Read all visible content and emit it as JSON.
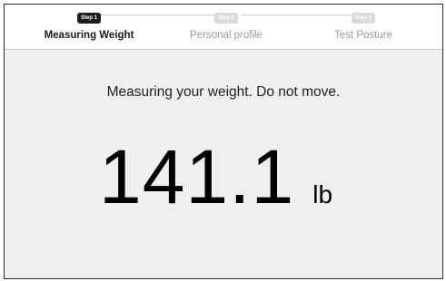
{
  "stepper": {
    "steps": [
      {
        "badge": "Step 1",
        "label": "Measuring Weight",
        "active": true
      },
      {
        "badge": "Step 2",
        "label": "Personal profile",
        "active": false
      },
      {
        "badge": "Step 3",
        "label": "Test Posture",
        "active": false
      }
    ]
  },
  "main": {
    "instruction": "Measuring your weight. Do not move.",
    "weight_value": "141.1",
    "weight_unit": "lb"
  },
  "colors": {
    "active_step": "#1c1c1c",
    "inactive_step": "#d9d9d9",
    "background": "#efefef"
  }
}
